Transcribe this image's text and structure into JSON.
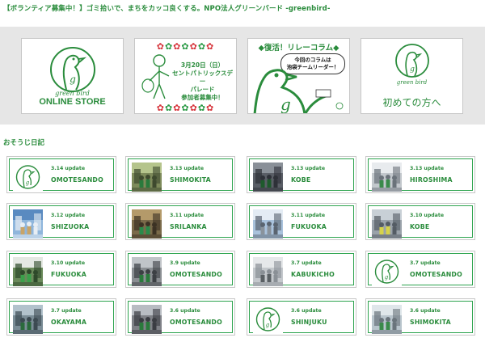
{
  "page": {
    "title": "【ボランティア募集中！】ゴミ拾いで、まちをカッコ良くする。NPO法人グリーンバード -greenbird-",
    "section_title": "おそうじ日記"
  },
  "banners": {
    "store": {
      "brand": "green bird",
      "label": "ONLINE STORE"
    },
    "event": {
      "stars": "✿✿✿✿✿✿✿",
      "text": "3月20日（日）\nセントパトリックスデー\nパレード\n参加者募集中！"
    },
    "relay": {
      "title": "◆復活！リレーコラム◆",
      "bubble": "今回のコラムは\n池袋チームリーダー！"
    },
    "first": {
      "brand": "green bird",
      "label": "初めての方へ"
    }
  },
  "diary": [
    {
      "date": "3.14 update",
      "place": "OMOTESANDO",
      "thumb": "logo"
    },
    {
      "date": "3.13 update",
      "place": "SHIMOKITA",
      "thumb": "group-park"
    },
    {
      "date": "3.13 update",
      "place": "KOBE",
      "thumb": "street-dark"
    },
    {
      "date": "3.13 update",
      "place": "HIROSHIMA",
      "thumb": "street-building"
    },
    {
      "date": "3.12 update",
      "place": "SHIZUOKA",
      "thumb": "castle-sky"
    },
    {
      "date": "3.11 update",
      "place": "SRILANKA",
      "thumb": "hut-group"
    },
    {
      "date": "3.11 update",
      "place": "FUKUOKA",
      "thumb": "city-sky"
    },
    {
      "date": "3.10 update",
      "place": "KOBE",
      "thumb": "road-vests"
    },
    {
      "date": "3.10 update",
      "place": "FUKUOKA",
      "thumb": "green-room"
    },
    {
      "date": "3.9 update",
      "place": "OMOTESANDO",
      "thumb": "group-grey"
    },
    {
      "date": "3.7 update",
      "place": "KABUKICHO",
      "thumb": "street-pale"
    },
    {
      "date": "3.7 update",
      "place": "OMOTESANDO",
      "thumb": "logo"
    },
    {
      "date": "3.7 update",
      "place": "OKAYAMA",
      "thumb": "group-outdoor"
    },
    {
      "date": "3.6 update",
      "place": "OMOTESANDO",
      "thumb": "group-city"
    },
    {
      "date": "3.6 update",
      "place": "SHINJUKU",
      "thumb": "logo"
    },
    {
      "date": "3.6 update",
      "place": "SHIMOKITA",
      "thumb": "street-jump"
    }
  ],
  "colors": {
    "brand_green": "#2a8c3c",
    "card_border": "#2ea44f",
    "band_grey": "#e6e6e6"
  }
}
